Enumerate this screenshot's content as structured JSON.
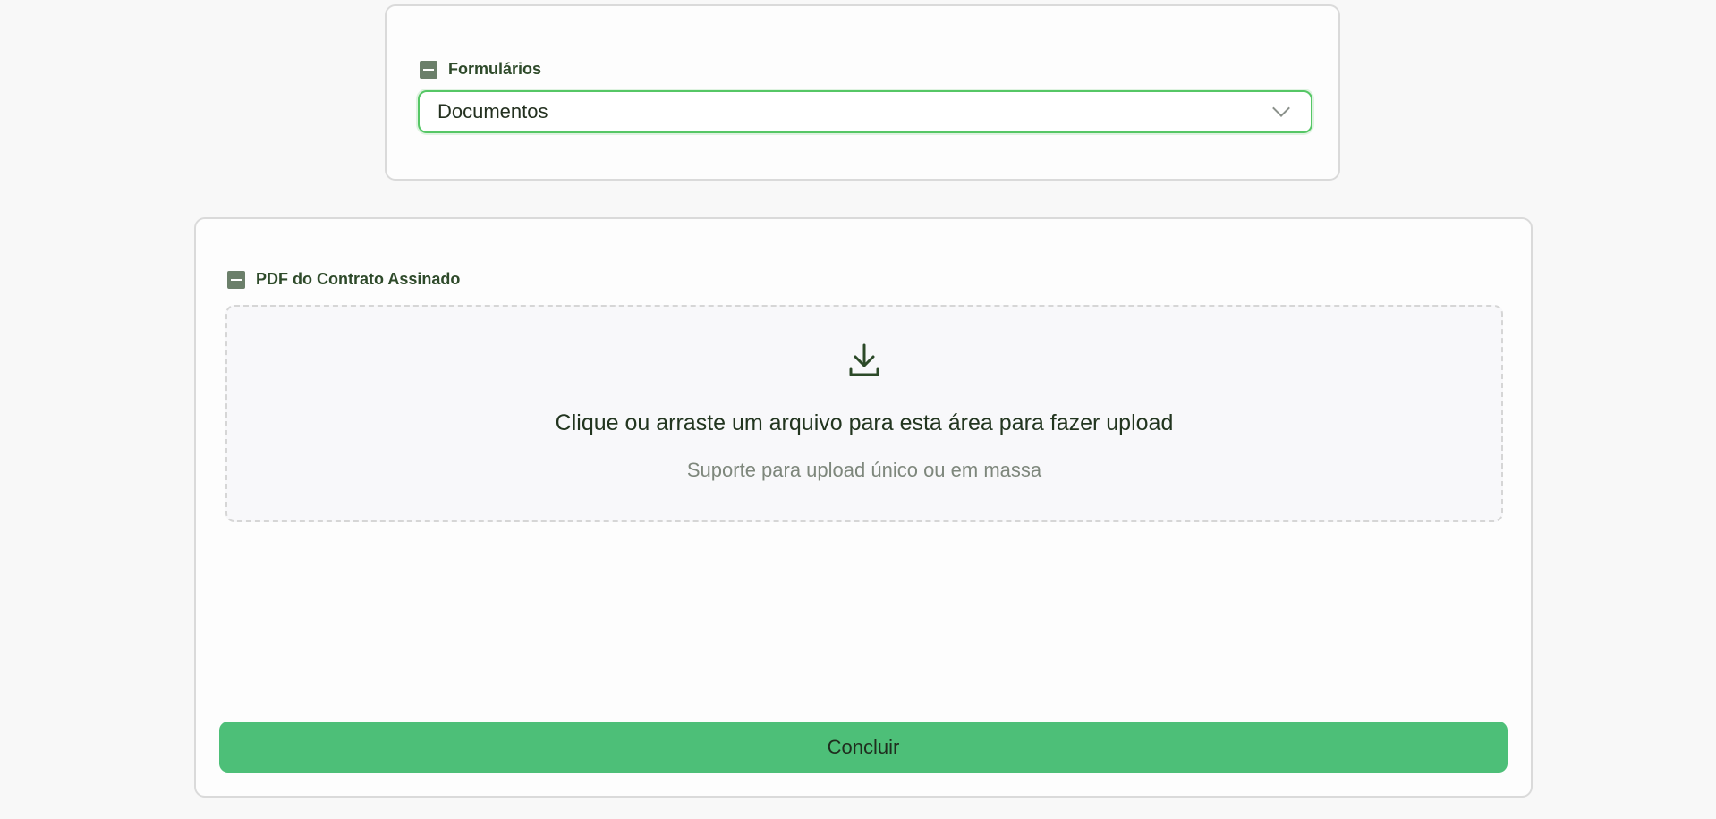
{
  "forms_section": {
    "label": "Formulários",
    "select_value": "Documentos",
    "toggle_icon": "minus-square-icon",
    "dropdown_icon": "chevron-down-icon"
  },
  "upload_section": {
    "label": "PDF do Contrato Assinado",
    "toggle_icon": "minus-square-icon",
    "dropzone": {
      "icon": "download-icon",
      "title": "Clique ou arraste um arquivo para esta área para fazer upload",
      "hint": "Suporte para upload único ou em massa"
    },
    "submit_label": "Concluir"
  },
  "colors": {
    "accent_green": "#4dbf78",
    "select_focus_border": "#56c766",
    "icon_dark": "#6b7f6a",
    "label_text": "#2e4a2a"
  }
}
